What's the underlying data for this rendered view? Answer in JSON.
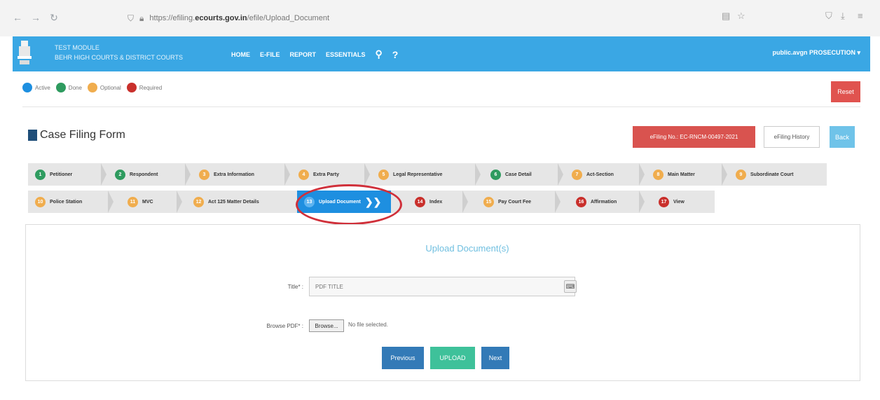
{
  "browser": {
    "url_prefix": "https://efiling.",
    "url_domain": "ecourts.gov.in",
    "url_suffix": "/efile/Upload_Document"
  },
  "header": {
    "title_line1": "TEST MODULE",
    "title_line2": "BEHR HIGH COURTS & DISTRICT COURTS",
    "menu": [
      "HOME",
      "E-FILE",
      "REPORT",
      "ESSENTIALS"
    ],
    "user": "public.avgn PROSECUTION"
  },
  "legend": {
    "items": [
      {
        "label": "Active",
        "color": "#1e8fe0"
      },
      {
        "label": "Done",
        "color": "#2e9b5f"
      },
      {
        "label": "Optional",
        "color": "#f0ad4e"
      },
      {
        "label": "Required",
        "color": "#c9302c"
      }
    ],
    "reset_label": "Reset"
  },
  "form": {
    "title": "Case Filing Form",
    "efiling_no_label": "eFiling No.: EC-RNCM-00497-2021",
    "history_label": "eFiling History",
    "back_label": "Back"
  },
  "tabs_row1": [
    {
      "num": "1",
      "label": "Petitioner",
      "status": "done"
    },
    {
      "num": "2",
      "label": "Respondent",
      "status": "done"
    },
    {
      "num": "3",
      "label": "Extra Information",
      "status": "optional"
    },
    {
      "num": "4",
      "label": "Extra Party",
      "status": "optional"
    },
    {
      "num": "5",
      "label": "Legal Representative",
      "status": "optional"
    },
    {
      "num": "6",
      "label": "Case Detail",
      "status": "done"
    },
    {
      "num": "7",
      "label": "Act-Section",
      "status": "optional"
    },
    {
      "num": "8",
      "label": "Main Matter",
      "status": "optional"
    },
    {
      "num": "9",
      "label": "Subordinate Court",
      "status": "optional"
    }
  ],
  "tabs_row2": [
    {
      "num": "10",
      "label": "Police Station",
      "status": "optional"
    },
    {
      "num": "11",
      "label": "MVC",
      "status": "optional"
    },
    {
      "num": "12",
      "label": "Act 125 Matter Details",
      "status": "optional"
    },
    {
      "num": "13",
      "label": "Upload Document",
      "status": "active"
    },
    {
      "num": "14",
      "label": "Index",
      "status": "required"
    },
    {
      "num": "15",
      "label": "Pay Court Fee",
      "status": "optional"
    },
    {
      "num": "16",
      "label": "Affirmation",
      "status": "required"
    },
    {
      "num": "17",
      "label": "View",
      "status": "required"
    }
  ],
  "upload": {
    "heading": "Upload Document(s)",
    "title_label": "Title* :",
    "title_placeholder": "PDF TITLE",
    "browse_label": "Browse PDF* :",
    "browse_button": "Browse...",
    "file_status": "No file selected.",
    "prev_label": "Previous",
    "upload_label": "UPLOAD",
    "next_label": "Next"
  }
}
